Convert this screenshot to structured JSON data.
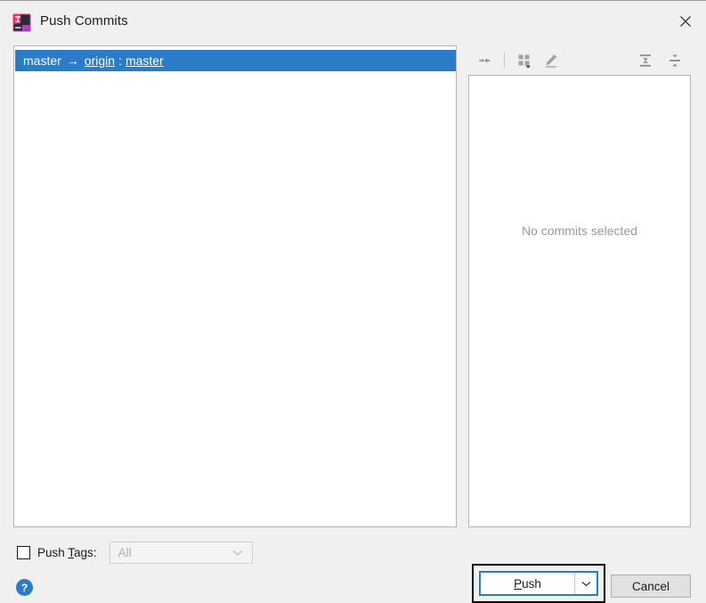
{
  "window": {
    "title": "Push Commits",
    "app_icon": "intellij-idea-icon",
    "close_icon": "close-icon"
  },
  "commit_list": {
    "rows": [
      {
        "source_branch": "master",
        "arrow": "→",
        "remote": "origin",
        "separator": ":",
        "target_branch": "master",
        "selected": true
      }
    ]
  },
  "toolbar": {
    "buttons": [
      {
        "name": "collapse-to-left-icon",
        "title": "Show Diff"
      },
      {
        "name": "group-by-icon",
        "title": "Group By"
      },
      {
        "name": "edit-icon",
        "title": "Edit"
      },
      {
        "name": "expand-all-icon",
        "title": "Expand All"
      },
      {
        "name": "collapse-all-icon",
        "title": "Collapse All"
      }
    ]
  },
  "details": {
    "empty_message": "No commits selected"
  },
  "push_tags": {
    "label_prefix": "Push ",
    "label_mnemonic": "T",
    "label_suffix": "ags:",
    "checked": false,
    "select_value": "All",
    "select_enabled": false,
    "chevron_icon": "chevron-down-icon"
  },
  "help": {
    "glyph": "?",
    "icon": "help-icon"
  },
  "actions": {
    "push_prefix": "",
    "push_mnemonic": "P",
    "push_suffix": "ush",
    "push_dropdown_icon": "chevron-down-icon",
    "cancel_label": "Cancel"
  },
  "colors": {
    "selection_blue": "#2a7cc7",
    "focus_border": "#2a7cc7",
    "dialog_bg": "#f0f0f0",
    "panel_bg": "#ffffff",
    "muted_text": "#9a9a9a"
  }
}
